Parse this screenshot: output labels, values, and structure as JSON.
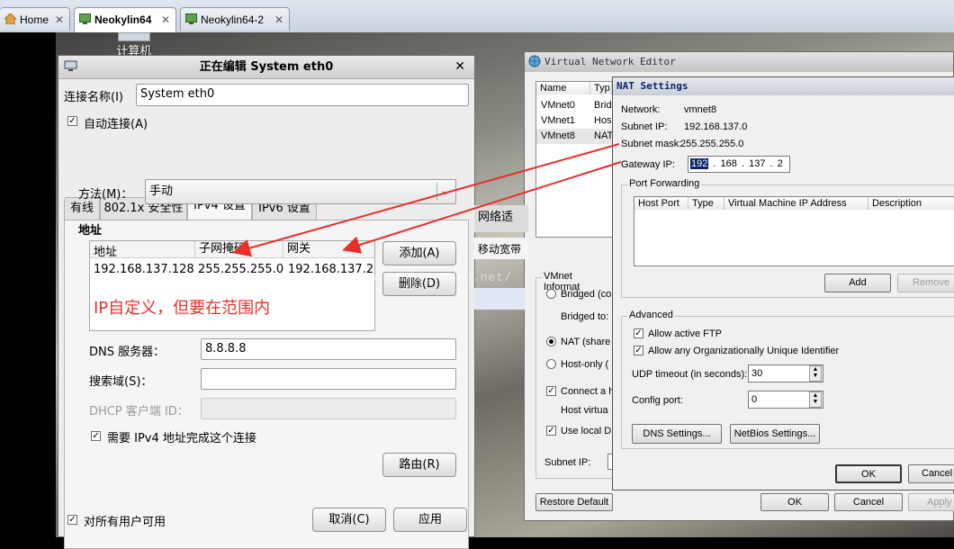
{
  "browser_tabs": [
    {
      "label": "Home",
      "icon": "home-icon"
    },
    {
      "label": "Neokylin64",
      "icon": "vm-icon",
      "active": true
    },
    {
      "label": "Neokylin64-2",
      "icon": "vm-icon"
    }
  ],
  "desktop_icon_label": "计算机",
  "linux_dialog": {
    "title": "正在编辑 System eth0",
    "conn_name_label": "连接名称(I)",
    "conn_name_value": "System eth0",
    "auto_connect_label": "自动连接(A)",
    "tabs": [
      "有线",
      "802.1x 安全性",
      "IPv4 设置",
      "IPv6 设置"
    ],
    "method_label": "方法(M)：",
    "method_value": "手动",
    "address_heading": "地址",
    "columns": [
      "地址",
      "子网掩码",
      "网关"
    ],
    "row": [
      "192.168.137.128",
      "255.255.255.0",
      "192.168.137.2"
    ],
    "annotation": "IP自定义，但要在范围内",
    "add_button": "添加(A)",
    "delete_button": "删除(D)",
    "dns_label": "DNS 服务器：",
    "dns_value": "8.8.8.8",
    "search_label": "搜索域(S)：",
    "dhcp_label": "DHCP 客户端 ID：",
    "require_ipv4_label": "需要 IPv4 地址完成这个连接",
    "routes_button": "路由(R)",
    "all_users_label": "对所有用户可用",
    "cancel_button": "取消(C)",
    "apply_button": "应用"
  },
  "vne": {
    "title": "Virtual Network Editor",
    "list_headers": [
      "Name",
      "Typ"
    ],
    "list_rows": [
      [
        "VMnet0",
        "Brid"
      ],
      [
        "VMnet1",
        "Hos"
      ],
      [
        "VMnet8",
        "NAT"
      ]
    ],
    "partial_text_1": "网络适",
    "partial_text_2": "移动宽带",
    "vmnet_info_label": "VMnet Informat",
    "bridged": "Bridged (co",
    "bridged_to": "Bridged to:",
    "nat": "NAT (share",
    "host_only": "Host-only (",
    "connect": "Connect a h",
    "host_virtual": "Host virtua",
    "use_local": "Use local DH",
    "subnet_ip": "Subnet IP:",
    "restore_default": "Restore Default",
    "ok": "OK",
    "cancel": "Cancel",
    "apply": "Apply"
  },
  "nat": {
    "title": "NAT Settings",
    "network_label": "Network:",
    "network_value": "vmnet8",
    "subnet_ip_label": "Subnet IP:",
    "subnet_ip_value": "192.168.137.0",
    "subnet_mask_label": "Subnet mask:",
    "subnet_mask_value": "255.255.255.0",
    "gateway_label": "Gateway IP:",
    "gateway_octets": [
      "192",
      "168",
      "137",
      "2"
    ],
    "port_forwarding_label": "Port Forwarding",
    "pf_headers": [
      "Host Port",
      "Type",
      "Virtual Machine IP Address",
      "Description"
    ],
    "add": "Add",
    "remove": "Remove",
    "advanced_label": "Advanced",
    "allow_ftp": "Allow active FTP",
    "allow_oui": "Allow any Organizationally Unique Identifier",
    "udp_timeout_label": "UDP timeout (in seconds):",
    "udp_timeout_value": "30",
    "config_port_label": "Config port:",
    "config_port_value": "0",
    "dns_settings": "DNS Settings...",
    "netbios_settings": "NetBios Settings...",
    "ok": "OK",
    "cancel": "Cancel"
  },
  "watermark": "http://blog.csdn.net/",
  "colors": {
    "annotation": "#e8302a",
    "arrow": "#e8302a",
    "selection": "#0a246a",
    "nat_title": "#0a246a"
  }
}
